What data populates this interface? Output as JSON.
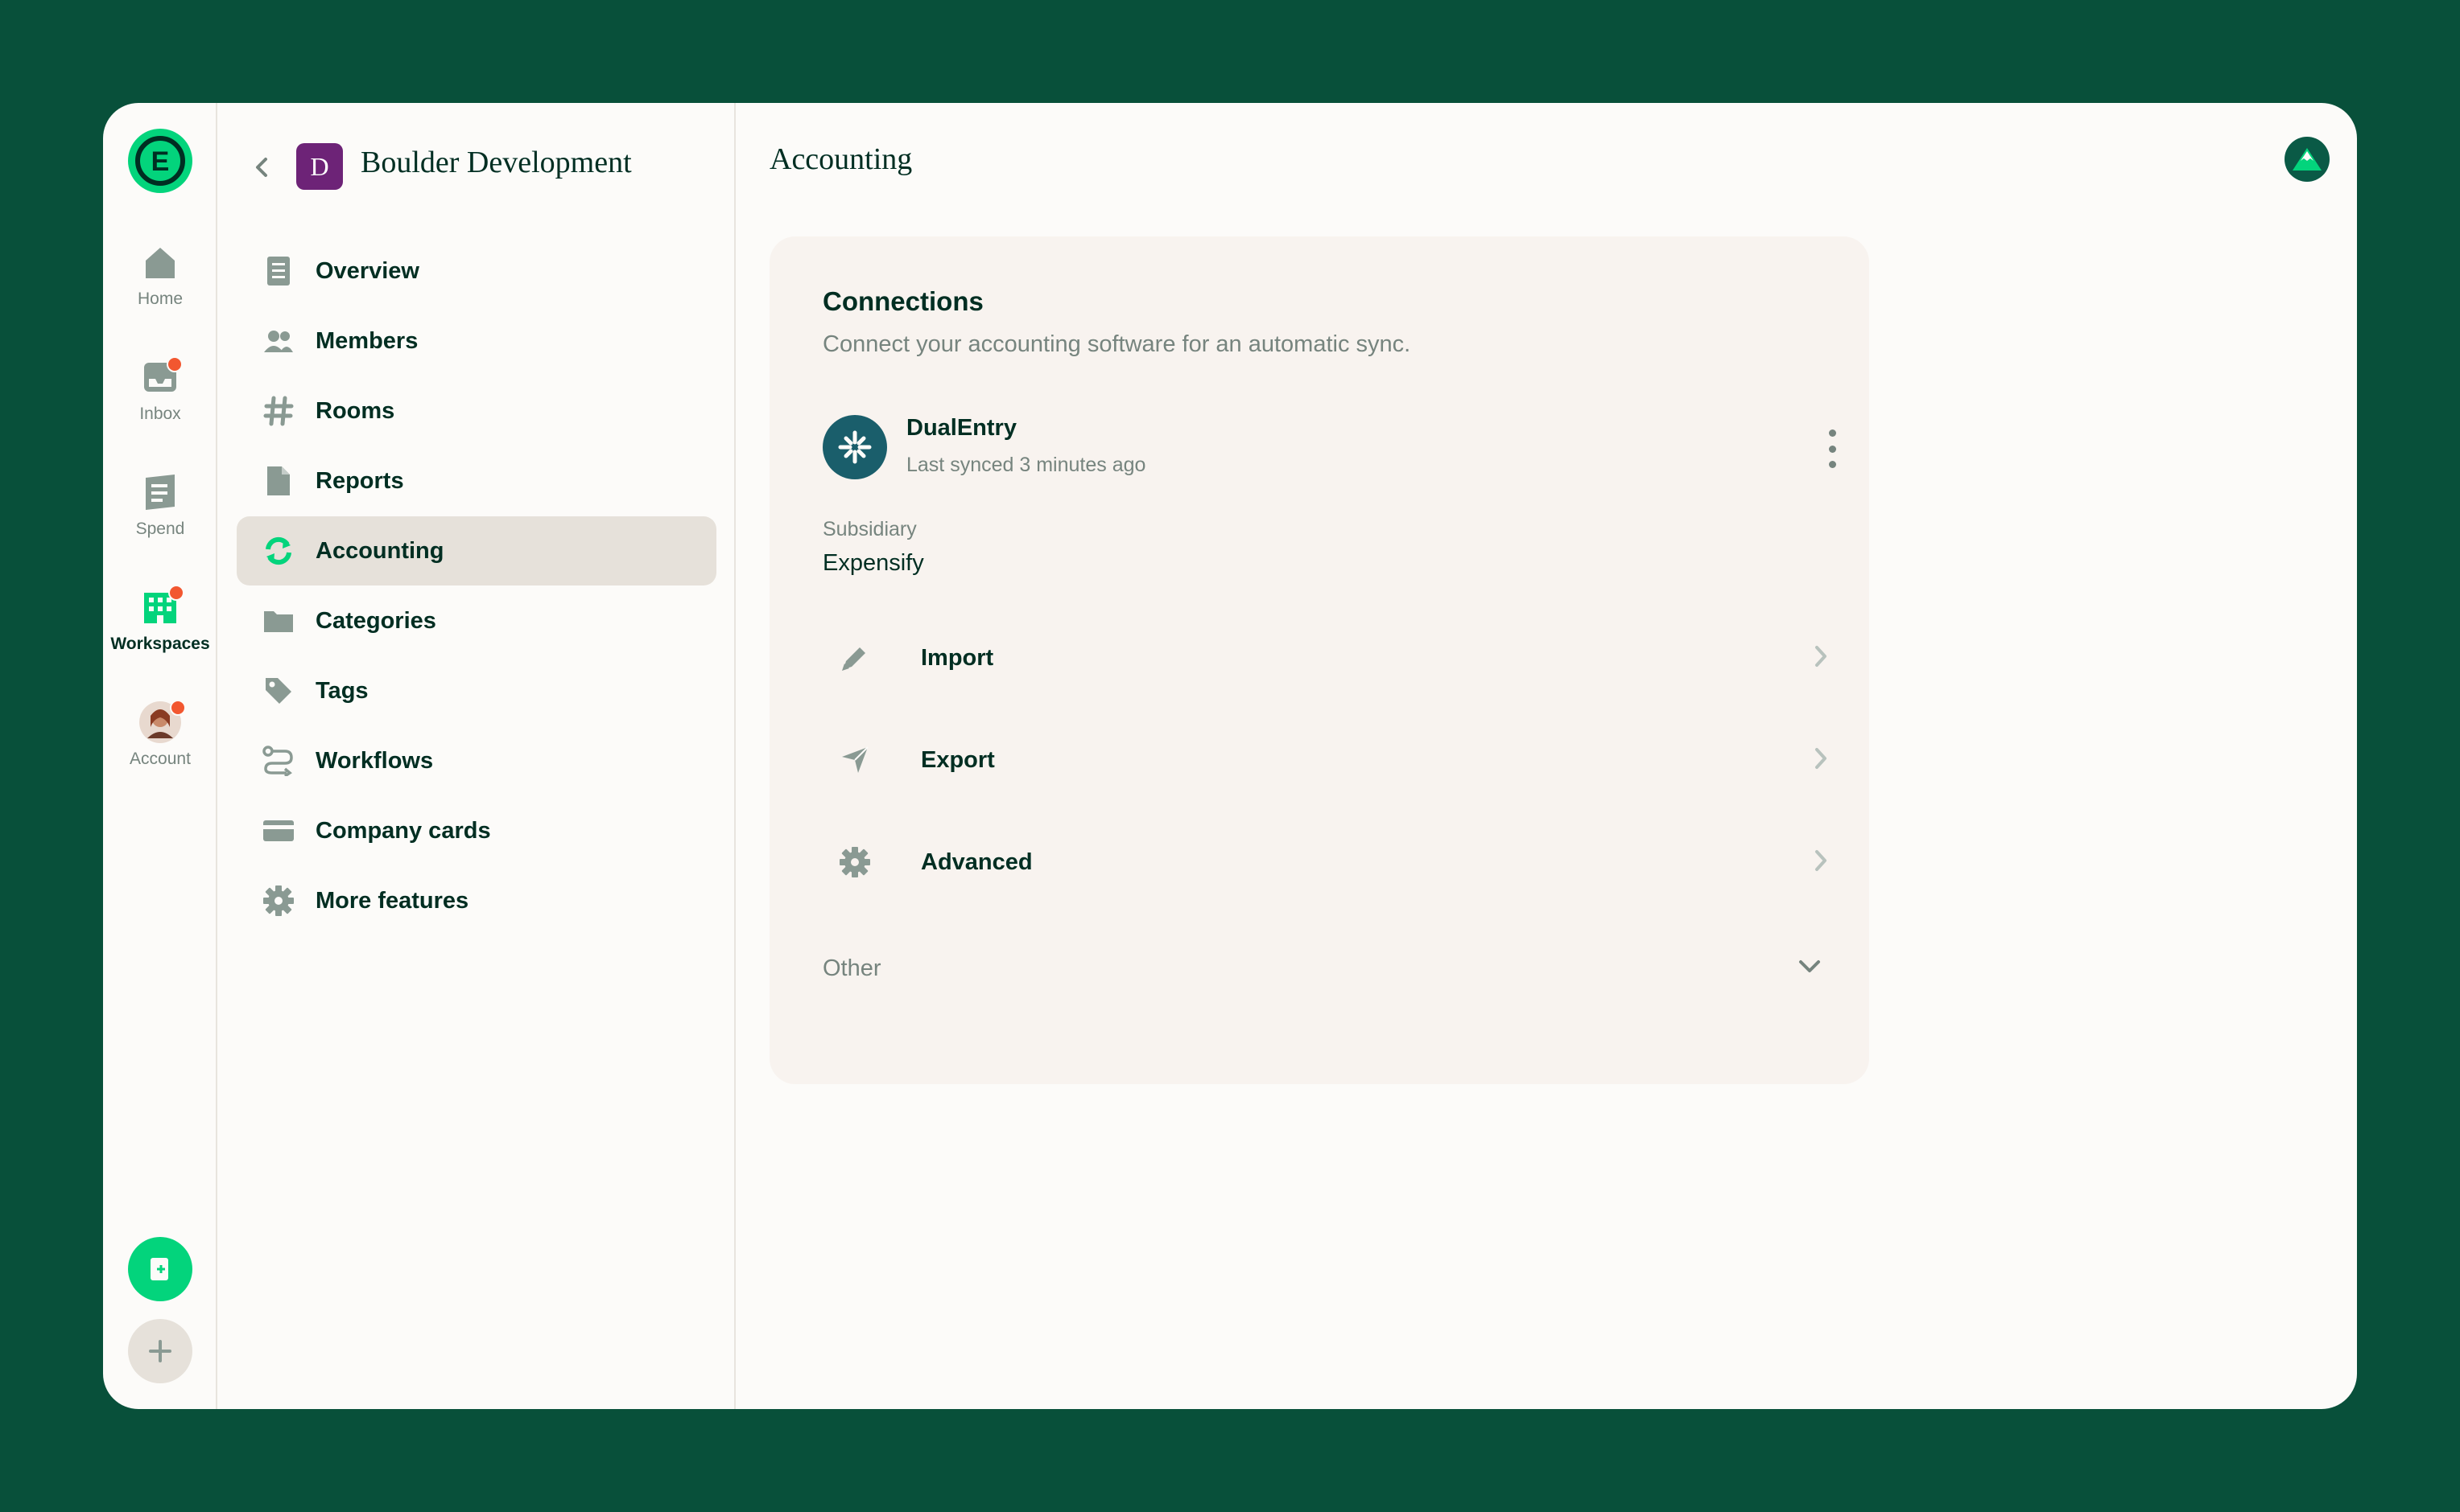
{
  "nav_rail": {
    "items": [
      {
        "label": "Home",
        "icon": "home-icon",
        "badge": false
      },
      {
        "label": "Inbox",
        "icon": "inbox-icon",
        "badge": true
      },
      {
        "label": "Spend",
        "icon": "receipt-icon",
        "badge": false
      },
      {
        "label": "Workspaces",
        "icon": "building-icon",
        "badge": true,
        "active": true
      },
      {
        "label": "Account",
        "icon": "avatar",
        "badge": true
      }
    ],
    "logo": "expensify-logo",
    "logo_letter": "E"
  },
  "workspace": {
    "avatar_letter": "D",
    "name": "Boulder Development"
  },
  "sidebar": {
    "items": [
      {
        "label": "Overview",
        "icon": "document-icon"
      },
      {
        "label": "Members",
        "icon": "users-icon"
      },
      {
        "label": "Rooms",
        "icon": "hashtag-icon"
      },
      {
        "label": "Reports",
        "icon": "file-icon"
      },
      {
        "label": "Accounting",
        "icon": "sync-icon",
        "active": true
      },
      {
        "label": "Categories",
        "icon": "folder-icon"
      },
      {
        "label": "Tags",
        "icon": "tag-icon"
      },
      {
        "label": "Workflows",
        "icon": "workflow-icon"
      },
      {
        "label": "Company cards",
        "icon": "credit-card-icon"
      },
      {
        "label": "More features",
        "icon": "gear-icon"
      }
    ]
  },
  "main": {
    "title": "Accounting",
    "connections": {
      "title": "Connections",
      "subtitle": "Connect your accounting software for an automatic sync.",
      "integration": {
        "name": "DualEntry",
        "status": "Last synced 3 minutes ago"
      },
      "subsidiary_label": "Subsidiary",
      "subsidiary_value": "Expensify",
      "rows": [
        {
          "label": "Import",
          "icon": "pencil-icon"
        },
        {
          "label": "Export",
          "icon": "send-icon"
        },
        {
          "label": "Advanced",
          "icon": "gear-icon"
        }
      ],
      "other_label": "Other"
    }
  },
  "colors": {
    "background": "#08503a",
    "accent": "#03d47c",
    "badge": "#f25730",
    "active_row": "#e6e1da",
    "card": "#f8f3ef"
  }
}
